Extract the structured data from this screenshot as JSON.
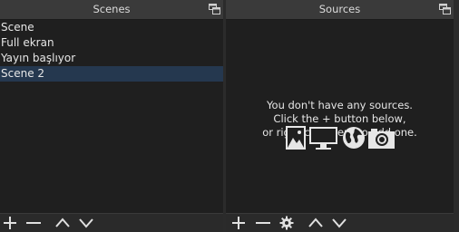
{
  "scenes_dock": {
    "title": "Scenes",
    "items": [
      {
        "label": "Scene"
      },
      {
        "label": "Full ekran"
      },
      {
        "label": "Yayın başlıyor"
      },
      {
        "label": "Scene 2",
        "selected": true
      }
    ],
    "toolbar": [
      "add-icon",
      "remove-icon",
      "move-up-icon",
      "move-down-icon"
    ]
  },
  "sources_dock": {
    "title": "Sources",
    "empty_message": {
      "line1": "You don't have any sources.",
      "line2": "Click the + button below,",
      "line3": "or right click here to add one."
    },
    "empty_icons": [
      "image-icon",
      "display-icon",
      "globe-icon",
      "camera-icon"
    ],
    "toolbar": [
      "add-icon",
      "remove-icon",
      "gear-icon",
      "move-up-icon",
      "move-down-icon"
    ]
  },
  "colors": {
    "panel_bg": "#1f1f1f",
    "titlebar_bg": "#3a3a3a",
    "selection": "#25384f",
    "text": "#e6e6e6"
  }
}
